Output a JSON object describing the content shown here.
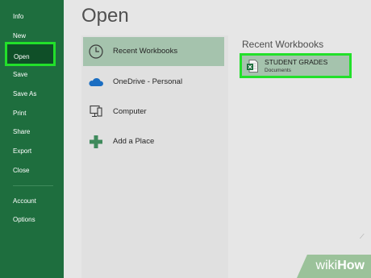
{
  "sidebar": {
    "items": [
      {
        "label": "Info"
      },
      {
        "label": "New"
      },
      {
        "label": "Open"
      },
      {
        "label": "Save"
      },
      {
        "label": "Save As"
      },
      {
        "label": "Print"
      },
      {
        "label": "Share"
      },
      {
        "label": "Export"
      },
      {
        "label": "Close"
      }
    ],
    "footer": [
      {
        "label": "Account"
      },
      {
        "label": "Options"
      }
    ],
    "selected": "Open"
  },
  "main": {
    "title": "Open",
    "locations": [
      {
        "label": "Recent Workbooks",
        "icon": "clock-icon"
      },
      {
        "label": "OneDrive - Personal",
        "icon": "cloud-icon"
      },
      {
        "label": "Computer",
        "icon": "computer-icon"
      },
      {
        "label": "Add a Place",
        "icon": "plus-icon"
      }
    ],
    "recent_heading": "Recent Workbooks",
    "recent_files": [
      {
        "name": "STUDENT GRADES",
        "location": "Documents",
        "icon": "excel-file-icon"
      }
    ],
    "scroll_glyph": "⟋"
  },
  "watermark": {
    "part1": "wiki",
    "part2": "How"
  },
  "colors": {
    "sidebar": "#1e6e3e",
    "sidebar_selected": "#0f4f28",
    "highlight_outline": "#22e02a",
    "selection_fill": "#a5c3ad",
    "background": "#e6e6e6"
  }
}
